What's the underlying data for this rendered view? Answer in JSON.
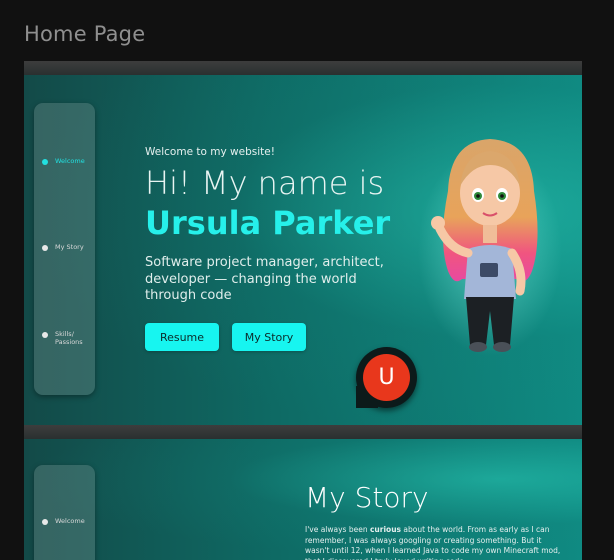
{
  "page": {
    "heading": "Home Page"
  },
  "hero": {
    "nav": [
      {
        "label": "Welcome",
        "active": true
      },
      {
        "label": "My Story",
        "active": false
      },
      {
        "label": "Skills/ Passions",
        "active": false
      }
    ],
    "welcome": "Welcome to my website!",
    "greeting": "Hi! My name is",
    "name": "Ursula Parker",
    "tagline": "Software project manager, architect, developer — changing the world through code",
    "buttons": {
      "resume": "Resume",
      "story": "My Story"
    },
    "badge_letter": "U",
    "colors": {
      "accent": "#17f5f0",
      "badge": "#e8371c"
    }
  },
  "story": {
    "nav_first": "Welcome",
    "title": "My Story",
    "body_start": "I've always been ",
    "body_bold": "curious",
    "body_rest": " about the world. From as early as I can remember, I was always googling or creating something. But it wasn't until 12, when I learned Java to code my own Minecraft mod, that I discovered I truly loved writing code."
  }
}
